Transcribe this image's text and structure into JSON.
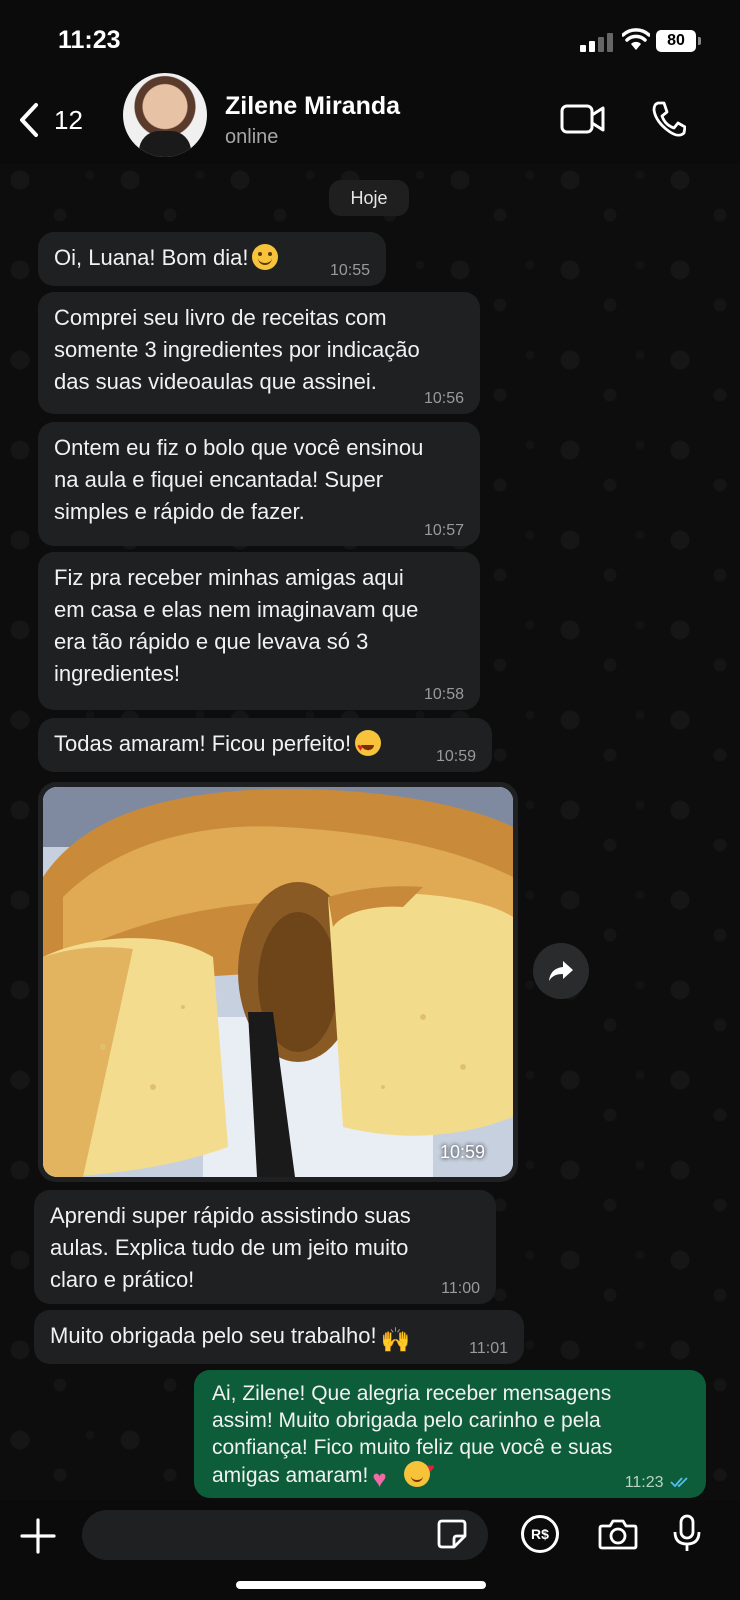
{
  "status_bar": {
    "time": "11:23",
    "battery": "80"
  },
  "header": {
    "back_count": "12",
    "contact_name": "Zilene Miranda",
    "contact_status": "online"
  },
  "date_separator": "Hoje",
  "messages": [
    {
      "text": "Oi, Luana! Bom dia!",
      "emoji": "smiling-face",
      "time": "10:55"
    },
    {
      "text": "Comprei seu livro de receitas com\nsomente 3 ingredientes por indicação\ndas suas videoaulas que assinei.",
      "time": "10:56"
    },
    {
      "text": "Ontem eu fiz o bolo que você ensinou\nna aula e fiquei encantada! Super\nsimples e rápido de fazer.",
      "time": "10:57"
    },
    {
      "text": "Fiz pra receber minhas amigas aqui\nem casa e elas nem imaginavam que\nera tão rápido e que levava só 3\ningredientes!",
      "time": "10:58"
    },
    {
      "text": "Todas amaram! Ficou perfeito!",
      "emoji": "heart-eyes",
      "time": "10:59"
    },
    {
      "photo": "bundt-cake-photo",
      "time": "10:59"
    },
    {
      "text": "Aprendi super rápido assistindo suas\naulas. Explica tudo de um jeito muito\nclaro e prático!",
      "time": "11:00"
    },
    {
      "text": "Muito obrigada pelo seu trabalho!",
      "emoji": "raising-hands",
      "time": "11:01"
    },
    {
      "text": "Ai, Zilene! Que alegria receber mensagens\nassim! Muito obrigada pelo carinho e pela\nconfiança! Fico muito feliz que você e suas\namigas amaram!",
      "emojis": [
        "pink-heart",
        "smiling-face-with-hearts"
      ],
      "time": "11:23",
      "outgoing": true,
      "read": true
    }
  ],
  "input_bar": {
    "pay_label": "R$"
  },
  "colors": {
    "incoming_bubble": "#1f2021",
    "outgoing_bubble": "#0d5d3b",
    "background": "#0b0b0b",
    "read_ticks": "#53bdeb"
  }
}
